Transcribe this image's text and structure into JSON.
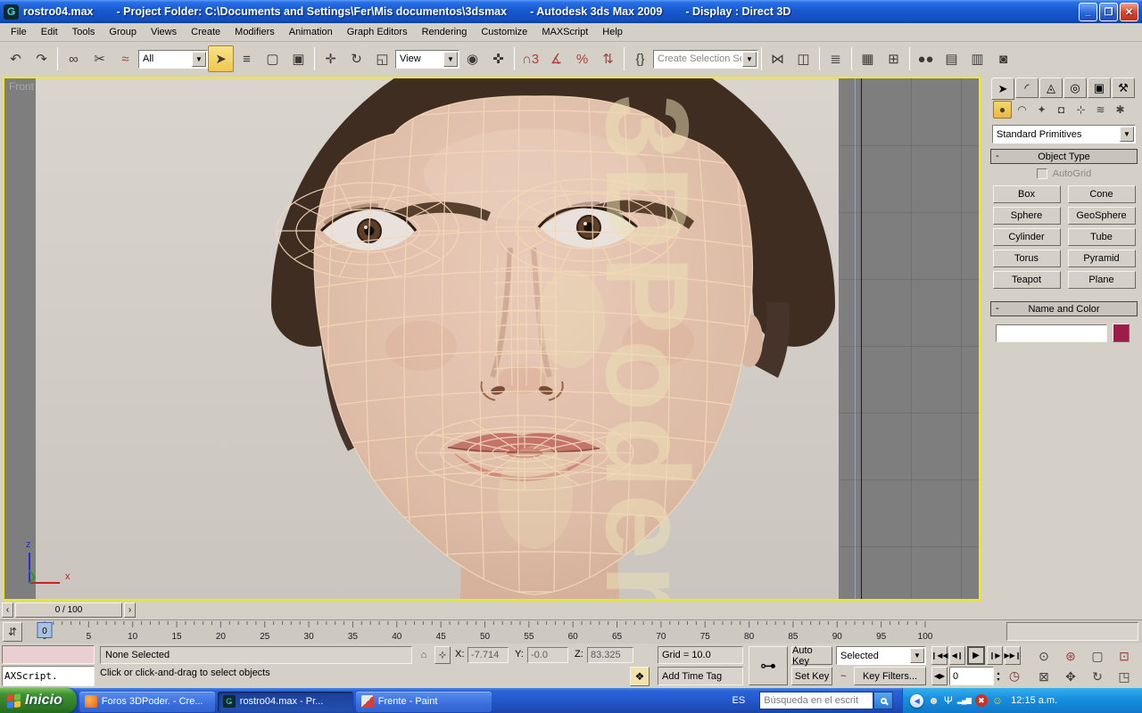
{
  "window": {
    "icon_glyph": "Ǥ",
    "doc": "rostro04.max",
    "project": "- Project Folder: C:\\Documents and Settings\\Fer\\Mis documentos\\3dsmax",
    "app": "- Autodesk 3ds Max  2009",
    "display_mode": "- Display : Direct 3D",
    "minimize": "_",
    "restore": "❐",
    "close": "✕"
  },
  "menus": [
    "File",
    "Edit",
    "Tools",
    "Group",
    "Views",
    "Create",
    "Modifiers",
    "Animation",
    "Graph Editors",
    "Rendering",
    "Customize",
    "MAXScript",
    "Help"
  ],
  "toolbar": {
    "selection_filter": "All",
    "coordinate_system": "View",
    "selection_set_placeholder": "Create Selection Set"
  },
  "icons": {
    "undo": "↶",
    "redo": "↷",
    "link": "∞",
    "unlink": "✂",
    "bind": "≈",
    "select": "➤",
    "byname": "≡",
    "region": "▢",
    "crossing": "▣",
    "move": "✛",
    "rotate": "↻",
    "scale": "◱",
    "pivot": "◉",
    "manip": "✜",
    "snap": "∩3",
    "angle": "∡",
    "percent": "%",
    "spinner": "⇅",
    "namedsel": "{}",
    "mirror": "⋈",
    "align": "◫",
    "layers": "≣",
    "curveed": "▦",
    "schematic": "⊞",
    "material": "●●",
    "rendersetup": "▤",
    "renderframe": "▥",
    "render": "◙",
    "tab_create": "➤",
    "tab_modify": "◜",
    "tab_hierarchy": "◬",
    "tab_motion": "◎",
    "tab_display": "▣",
    "tab_utilities": "⚒",
    "cat_geometry": "●",
    "cat_shapes": "◠",
    "cat_lights": "✦",
    "cat_cameras": "◘",
    "cat_helpers": "⊹",
    "cat_spacewarps": "≋",
    "cat_systems": "✱",
    "arrow_down": "▼",
    "arrow_left": "‹",
    "arrow_right": "›",
    "minus": "-",
    "minitrack": "⇵",
    "lock": "⌂",
    "absoffset": "⊹",
    "degrade": "❖",
    "key": "⊶",
    "curve": "~",
    "go_start": "❙◀◀",
    "prev": "◀❙",
    "play": "▶",
    "next": "❙▶",
    "go_end": "▶▶❙",
    "keymode": "◀▶",
    "spin_up": "▴",
    "spin_down": "▾",
    "timecfg": "◷",
    "zoom": "⊙",
    "zoomall": "⊛",
    "extents": "▢",
    "extentsall": "⊡",
    "zoomregion": "⊠",
    "pan": "✥",
    "arcrotate": "↻",
    "maximize": "◳",
    "chevron": "◀",
    "user": "☻",
    "wifi": "Ψ",
    "signal": "▂▄▆",
    "security": "✖",
    "messenger": "☺"
  },
  "viewport": {
    "label": "Front",
    "axis_x": "x",
    "axis_z": "z"
  },
  "timeline": {
    "display": "0 / 100",
    "current": "0",
    "ticks": [
      0,
      5,
      10,
      15,
      20,
      25,
      30,
      35,
      40,
      45,
      50,
      55,
      60,
      65,
      70,
      75,
      80,
      85,
      90,
      95,
      100
    ]
  },
  "status": {
    "selection": "None Selected",
    "x_label": "X:",
    "x": "-7.714",
    "y_label": "Y:",
    "y": "-0.0",
    "z_label": "Z:",
    "z": "83.325",
    "grid": "Grid = 10.0",
    "add_time_tag": "Add Time Tag",
    "auto_key": "Auto Key",
    "set_key": "Set Key",
    "selection_set": "Selected",
    "key_filters": "Key Filters...",
    "frame": "0",
    "prompt": "Click or click-and-drag to select objects",
    "listener": "AXScript."
  },
  "panel": {
    "category_dropdown": "Standard Primitives",
    "object_type": "Object Type",
    "autogrid": "AutoGrid",
    "buttons": [
      "Box",
      "Cone",
      "Sphere",
      "GeoSphere",
      "Cylinder",
      "Tube",
      "Torus",
      "Pyramid",
      "Teapot",
      "Plane"
    ],
    "name_color": "Name and Color",
    "object_name": "",
    "color": "#9b1e4a"
  },
  "taskbar": {
    "start": "Inicio",
    "tasks": [
      {
        "label": "Foros 3DPoder. - Cre..."
      },
      {
        "label": "rostro04.max    - Pr..."
      },
      {
        "label": "Frente - Paint"
      }
    ],
    "lang": "ES",
    "search": "Búsqueda en el escrit",
    "time": "12:15 a.m."
  }
}
